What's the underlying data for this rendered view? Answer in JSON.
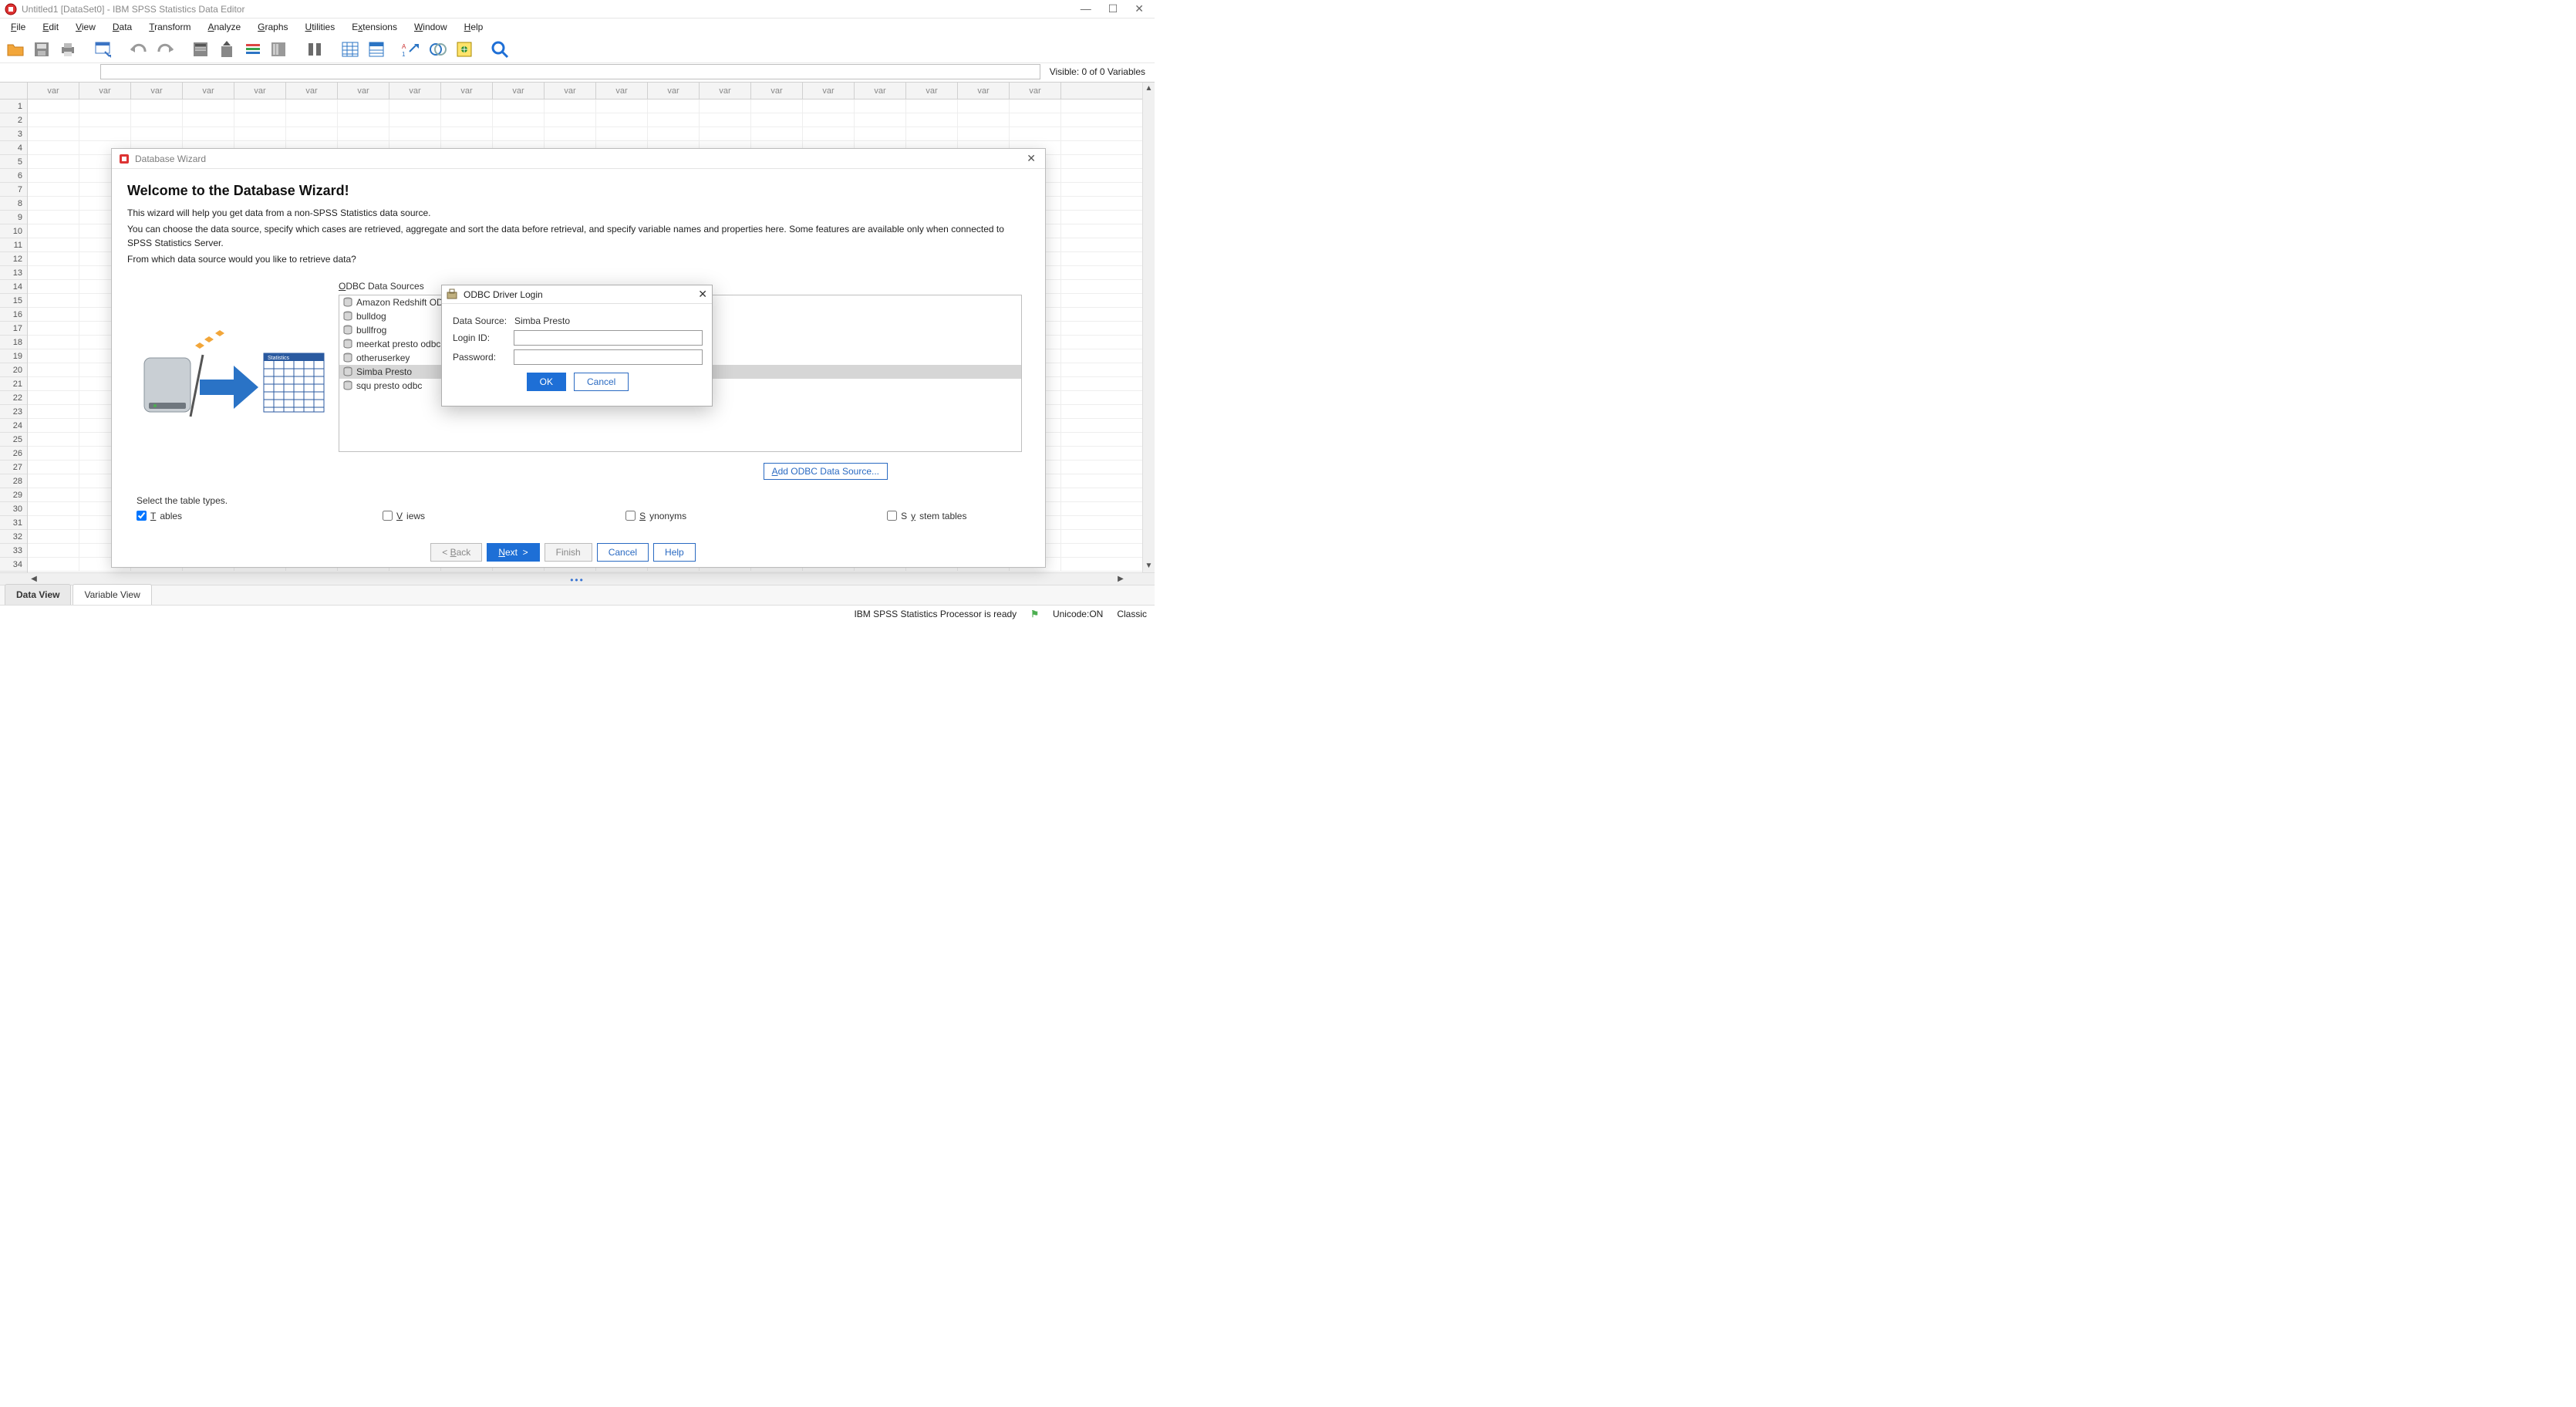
{
  "title": "Untitled1 [DataSet0] - IBM SPSS Statistics Data Editor",
  "window_controls": {
    "minimize": "—",
    "maximize": "☐",
    "close": "✕"
  },
  "menus": [
    "File",
    "Edit",
    "View",
    "Data",
    "Transform",
    "Analyze",
    "Graphs",
    "Utilities",
    "Extensions",
    "Window",
    "Help"
  ],
  "goto_value": "",
  "visible_label": "Visible: 0 of 0 Variables",
  "col_header_label": "var",
  "col_count": 20,
  "row_count": 34,
  "view_tabs": {
    "active": "Data View",
    "inactive": "Variable View"
  },
  "statusbar": {
    "processor": "IBM SPSS Statistics Processor is ready",
    "unicode": "Unicode:ON",
    "mode": "Classic"
  },
  "wizard": {
    "title": "Database Wizard",
    "heading": "Welcome to the Database Wizard!",
    "p1": "This wizard will help you get data from a non-SPSS Statistics data source.",
    "p2": "You can choose the data source, specify which cases are retrieved, aggregate and sort the data before retrieval, and specify variable names and properties here. Some features are available only when connected to SPSS Statistics Server.",
    "p3": "From which data source would you like to retrieve data?",
    "odbc_label": "ODBC Data Sources",
    "odbc_sources": [
      {
        "name": "Amazon Redshift ODBC",
        "selected": false
      },
      {
        "name": "bulldog",
        "selected": false
      },
      {
        "name": "bullfrog",
        "selected": false
      },
      {
        "name": "meerkat presto odbc",
        "selected": false
      },
      {
        "name": "otheruserkey",
        "selected": false
      },
      {
        "name": "Simba Presto",
        "selected": true
      },
      {
        "name": "squ presto odbc",
        "selected": false
      }
    ],
    "add_odbc_label": "Add ODBC Data Source...",
    "table_types_label": "Select the table types.",
    "checks": {
      "tables": {
        "label": "Tables",
        "checked": true
      },
      "views": {
        "label": "Views",
        "checked": false
      },
      "synonyms": {
        "label": "Synonyms",
        "checked": false
      },
      "system_tables": {
        "label": "System tables",
        "checked": false
      }
    },
    "nav": {
      "back": "< Back",
      "next": "Next  >",
      "finish": "Finish",
      "cancel": "Cancel",
      "help": "Help"
    }
  },
  "login": {
    "title": "ODBC Driver Login",
    "data_source_label": "Data Source:",
    "data_source_value": "Simba Presto",
    "login_id_label": "Login ID:",
    "login_id_value": "",
    "password_label": "Password:",
    "password_value": "",
    "ok": "OK",
    "cancel": "Cancel"
  }
}
